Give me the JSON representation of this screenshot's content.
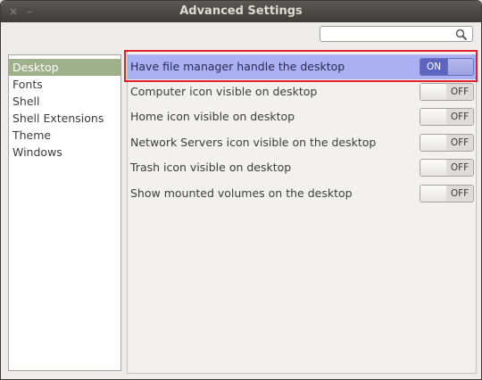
{
  "window": {
    "title": "Advanced Settings",
    "close_glyph": "×",
    "minimize_glyph": "–"
  },
  "search": {
    "value": "",
    "icon": "search-icon"
  },
  "sidebar": {
    "items": [
      {
        "label": "Desktop",
        "selected": true
      },
      {
        "label": "Fonts",
        "selected": false
      },
      {
        "label": "Shell",
        "selected": false
      },
      {
        "label": "Shell Extensions",
        "selected": false
      },
      {
        "label": "Theme",
        "selected": false
      },
      {
        "label": "Windows",
        "selected": false
      }
    ]
  },
  "desktop": {
    "rows": [
      {
        "label": "Have file manager handle the desktop",
        "state": "ON",
        "on": true,
        "highlighted": true
      },
      {
        "label": "Computer icon visible on desktop",
        "state": "OFF",
        "on": false
      },
      {
        "label": "Home icon visible on desktop",
        "state": "OFF",
        "on": false
      },
      {
        "label": "Network Servers icon visible on the desktop",
        "state": "OFF",
        "on": false
      },
      {
        "label": "Trash icon visible on desktop",
        "state": "OFF",
        "on": false
      },
      {
        "label": "Show mounted volumes on the desktop",
        "state": "OFF",
        "on": false
      }
    ]
  },
  "colors": {
    "highlight_frame": "#e0202a",
    "selected_sidebar": "#9fb18a",
    "highlight_row": "#aab0f2"
  }
}
